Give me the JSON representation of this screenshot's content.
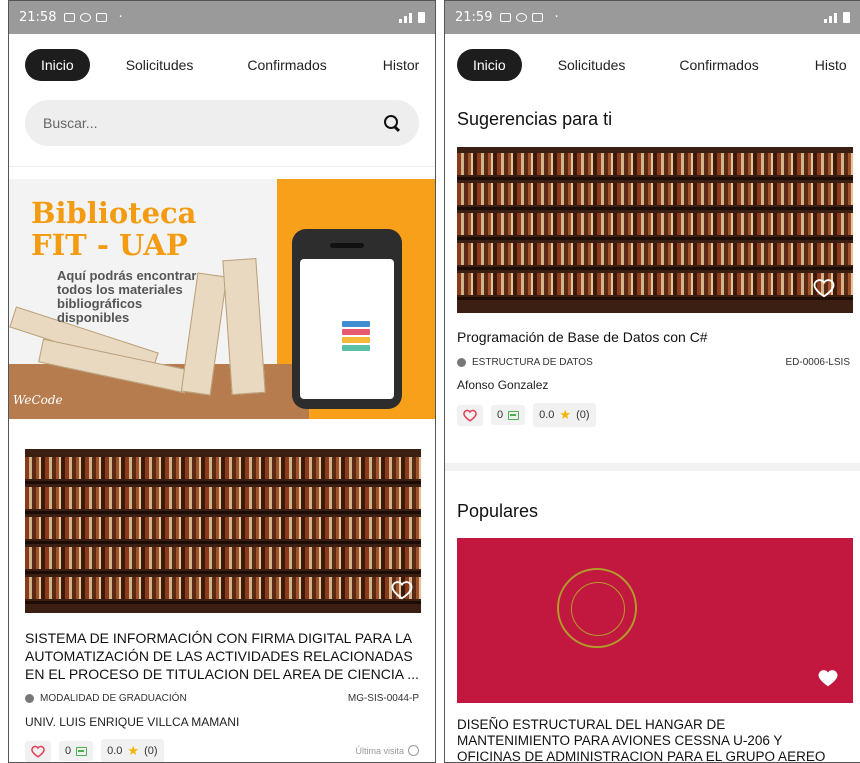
{
  "left": {
    "status": {
      "time": "21:58",
      "dot": "·"
    },
    "tabs": [
      "Inicio",
      "Solicitudes",
      "Confirmados",
      "Histor"
    ],
    "search": {
      "placeholder": "Buscar..."
    },
    "banner": {
      "title_line1": "Biblioteca",
      "title_line2": "FIT - UAP",
      "subtitle_line1": "Aquí podrás encontrar",
      "subtitle_line2": "todos los materiales",
      "subtitle_line3": "bibliográficos",
      "subtitle_line4": "disponibles",
      "brand": "WeCode"
    },
    "card": {
      "title": "SISTEMA DE INFORMACIÓN CON FIRMA DIGITAL PARA LA AUTOMATIZACIÓN DE LAS ACTIVIDADES RELACIONADAS EN EL PROCESO DE TITULACION DEL AREA DE CIENCIA ...",
      "category": "MODALIDAD DE GRADUACIÓN",
      "code": "MG-SIS-0044-P",
      "author": "UNIV. LUIS ENRIQUE VILLCA MAMANI",
      "comments": "0",
      "rating": "0.0",
      "rating_count": "(0)",
      "last_visit": "Última visita"
    }
  },
  "right": {
    "status": {
      "time": "21:59",
      "dot": "·"
    },
    "tabs": [
      "Inicio",
      "Solicitudes",
      "Confirmados",
      "Histo"
    ],
    "suggestions": {
      "heading": "Sugerencias para ti",
      "card": {
        "title": "Programación de Base de Datos con C#",
        "category": "ESTRUCTURA DE DATOS",
        "code": "ED-0006-LSIS",
        "author": "Afonso Gonzalez",
        "comments": "0",
        "rating": "0.0",
        "rating_count": "(0)"
      }
    },
    "popular": {
      "heading": "Populares",
      "card_title_line1": "DISEÑO ESTRUCTURAL DEL HANGAR DE",
      "card_title_line2": "MANTENIMIENTO PARA AVIONES CESSNA U-206 Y",
      "card_title_line3": "OFICINAS DE ADMINISTRACION PARA EL GRUPO AEREO"
    }
  },
  "colors": {
    "accent_active": "#1d1d1d",
    "heart": "#e53950",
    "star": "#f5b400",
    "comment": "#4caf50",
    "banner_orange": "#f9a01b"
  }
}
